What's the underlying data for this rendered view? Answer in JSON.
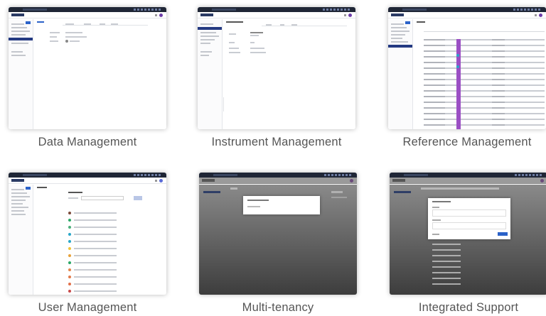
{
  "captions": {
    "data_management": "Data Management",
    "instrument_management": "Instrument Management",
    "reference_management": "Reference Management",
    "user_management": "User Management",
    "multi_tenancy": "Multi-tenancy",
    "integrated_support": "Integrated Support"
  },
  "colors": {
    "app_bar": "#1f2636",
    "sidebar_active": "#243a82",
    "badge_purple": "#9b4fc4",
    "badge_teal": "#29a7c9",
    "overlay": "#5a5a5a"
  }
}
